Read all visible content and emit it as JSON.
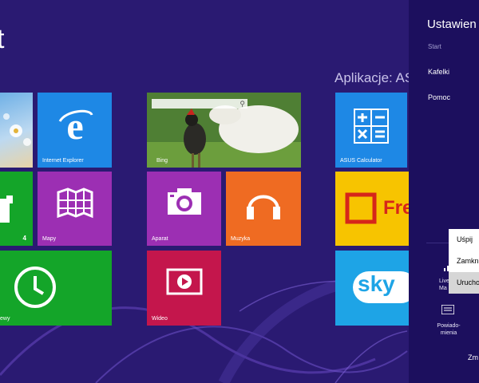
{
  "start": {
    "title": "t"
  },
  "group": {
    "title": "Aplikacje: ASUS"
  },
  "tiles": {
    "ie": "Internet Explorer",
    "bing": "Bing",
    "calc": "ASUS Calculator",
    "people_count": "4",
    "maps": "Mapy",
    "camera": "Aparat",
    "music": "Muzyka",
    "fresh": "Fre",
    "alarms": "ewy",
    "video": "Wideo",
    "skype": "sky"
  },
  "settings": {
    "title": "Ustawien",
    "subtitle": "Start",
    "links": [
      "Kafelki",
      "Pomoc"
    ],
    "network_label": [
      "Live",
      "Ma"
    ],
    "notifications_label": [
      "Powiado-",
      "mienia"
    ],
    "change_pc_settings": "Zm"
  },
  "power_menu": {
    "items": [
      "Uśpij",
      "Zamknij",
      "Uruchom ponownie"
    ],
    "highlighted": 2
  },
  "colors": {
    "background": "#2a1a72",
    "charm": "#1c0f5e",
    "blue": "#1e88e5",
    "purple": "#9c2fb3",
    "green": "#14a529",
    "orange": "#ef6b22",
    "red": "#c4164c",
    "yellow": "#f7c400"
  }
}
